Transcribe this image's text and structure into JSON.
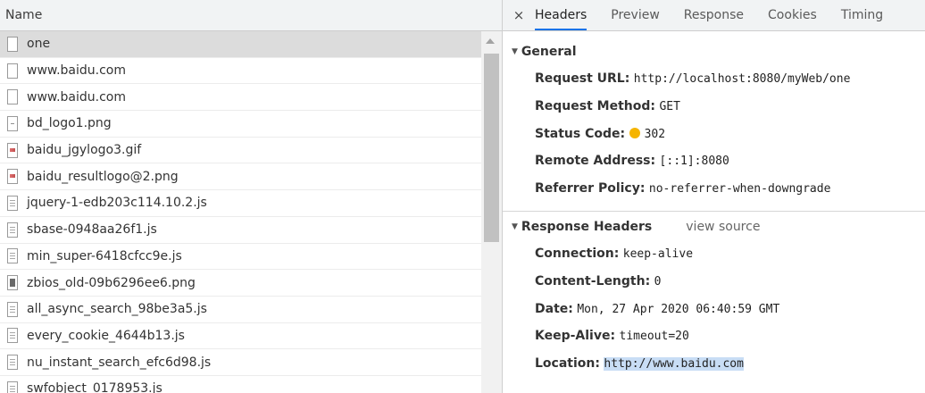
{
  "file_list": {
    "header": "Name",
    "items": [
      {
        "name": "one",
        "icon": "blank-doc-icon",
        "selected": true
      },
      {
        "name": "www.baidu.com",
        "icon": "blank-doc-icon"
      },
      {
        "name": "www.baidu.com",
        "icon": "blank-doc-icon"
      },
      {
        "name": "bd_logo1.png",
        "icon": "image-file-icon"
      },
      {
        "name": "baidu_jgylogo3.gif",
        "icon": "image-file-icon"
      },
      {
        "name": "baidu_resultlogo@2.png",
        "icon": "image-file-icon"
      },
      {
        "name": "jquery-1-edb203c114.10.2.js",
        "icon": "script-file-icon"
      },
      {
        "name": "sbase-0948aa26f1.js",
        "icon": "script-file-icon"
      },
      {
        "name": "min_super-6418cfcc9e.js",
        "icon": "script-file-icon"
      },
      {
        "name": "zbios_old-09b6296ee6.png",
        "icon": "image-file-icon"
      },
      {
        "name": "all_async_search_98be3a5.js",
        "icon": "script-file-icon"
      },
      {
        "name": "every_cookie_4644b13.js",
        "icon": "script-file-icon"
      },
      {
        "name": "nu_instant_search_efc6d98.js",
        "icon": "script-file-icon"
      },
      {
        "name": "swfobject_0178953.js",
        "icon": "script-file-icon"
      }
    ]
  },
  "detail_tabs": {
    "close": "×",
    "tabs": [
      "Headers",
      "Preview",
      "Response",
      "Cookies",
      "Timing"
    ],
    "active": "Headers"
  },
  "general": {
    "title": "General",
    "rows": [
      {
        "key": "Request URL:",
        "value": "http://localhost:8080/myWeb/one"
      },
      {
        "key": "Request Method:",
        "value": "GET"
      },
      {
        "key": "Status Code:",
        "value": "302",
        "status_color": "#f5b400"
      },
      {
        "key": "Remote Address:",
        "value": "[::1]:8080"
      },
      {
        "key": "Referrer Policy:",
        "value": "no-referrer-when-downgrade"
      }
    ]
  },
  "response_headers": {
    "title": "Response Headers",
    "view_source": "view source",
    "rows": [
      {
        "key": "Connection:",
        "value": "keep-alive"
      },
      {
        "key": "Content-Length:",
        "value": "0"
      },
      {
        "key": "Date:",
        "value": "Mon, 27 Apr 2020 06:40:59 GMT"
      },
      {
        "key": "Keep-Alive:",
        "value": "timeout=20"
      },
      {
        "key": "Location:",
        "value": "http://www.baidu.com",
        "highlighted": true
      }
    ]
  },
  "colors": {
    "accent": "#1a73e8",
    "selected_row": "#dcdcdc",
    "highlight": "#c8ddf5"
  }
}
